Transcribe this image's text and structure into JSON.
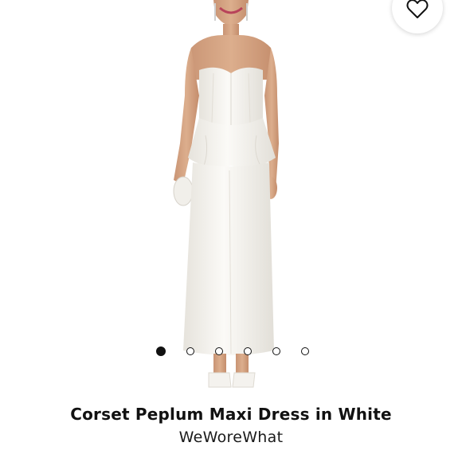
{
  "product": {
    "name": "Corset Peplum Maxi Dress in White",
    "brand": "WeWoreWhat"
  },
  "gallery": {
    "image_count": 6,
    "active_index": 0,
    "image_alt": "Model wearing white strapless corset peplum maxi dress"
  },
  "icons": {
    "wishlist": "heart-outline-icon"
  },
  "colors": {
    "dress": "#f4f2ee",
    "skin": "#d6a886",
    "dot_active": "#111111"
  }
}
